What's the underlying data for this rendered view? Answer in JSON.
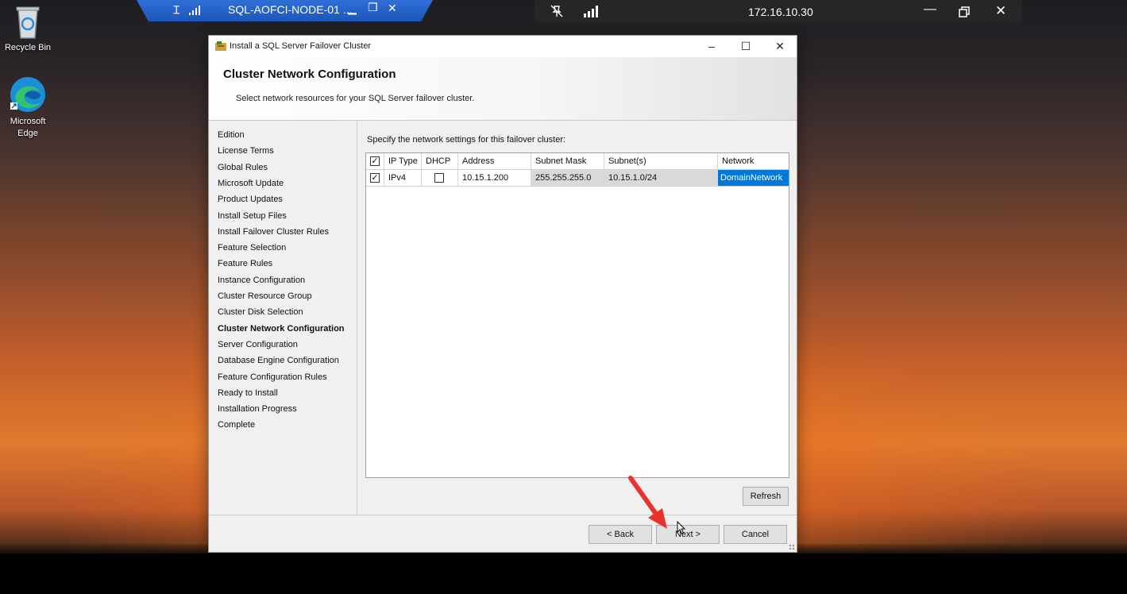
{
  "desktop": {
    "icons": [
      {
        "label": "Recycle Bin"
      },
      {
        "label": "Microsoft Edge"
      }
    ]
  },
  "rdp_bar_left": {
    "title": "SQL-AOFCI-NODE-01 ..."
  },
  "rdp_bar_right": {
    "address": "172.16.10.30"
  },
  "dialog": {
    "window_title": "Install a SQL Server Failover Cluster",
    "header_title": "Cluster Network Configuration",
    "header_subtitle": "Select network resources for your SQL Server failover cluster.",
    "nav_items": [
      "Edition",
      "License Terms",
      "Global Rules",
      "Microsoft Update",
      "Product Updates",
      "Install Setup Files",
      "Install Failover Cluster Rules",
      "Feature Selection",
      "Feature Rules",
      "Instance Configuration",
      "Cluster Resource Group",
      "Cluster Disk Selection",
      "Cluster Network Configuration",
      "Server Configuration",
      "Database Engine Configuration",
      "Feature Configuration Rules",
      "Ready to Install",
      "Installation Progress",
      "Complete"
    ],
    "active_nav": "Cluster Network Configuration",
    "instruction": "Specify the network settings for this failover cluster:",
    "grid": {
      "columns": [
        "IP Type",
        "DHCP",
        "Address",
        "Subnet Mask",
        "Subnet(s)",
        "Network"
      ],
      "rows": [
        {
          "selected": true,
          "ip_type": "IPv4",
          "dhcp": false,
          "address": "10.15.1.200",
          "subnet_mask": "255.255.255.0",
          "subnets": "10.15.1.0/24",
          "network": "DomainNetwork"
        }
      ]
    },
    "buttons": {
      "refresh": "Refresh",
      "back": "< Back",
      "next": "Next >",
      "cancel": "Cancel"
    }
  },
  "colors": {
    "selection": "#0078d7",
    "rdp_blue": "#1d56b8",
    "annotation_arrow": "#e8322b"
  }
}
